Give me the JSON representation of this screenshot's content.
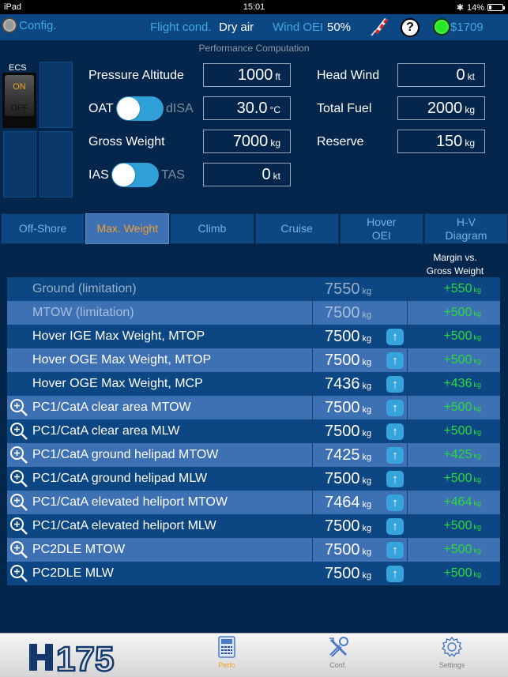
{
  "status_bar": {
    "device": "iPad",
    "time": "15:01",
    "battery": "14%"
  },
  "nav": {
    "config_label": "Config.",
    "flight_cond_label": "Flight cond.",
    "flight_cond_value": "Dry air",
    "wind_oei_label": "Wind OEI",
    "wind_oei_value": "50%",
    "help_label": "?",
    "status_code": "$1709"
  },
  "section_title": "Performance Computation",
  "ecs": {
    "label": "ECS",
    "on": "ON",
    "off": "OFF",
    "state": "ON"
  },
  "inputs": {
    "pressure_altitude": {
      "label": "Pressure Altitude",
      "value": "1000",
      "unit": "ft"
    },
    "oat": {
      "label": "OAT",
      "alt_label": "dISA",
      "value": "30.0",
      "unit": "°C",
      "toggle_on": true
    },
    "gross_weight": {
      "label": "Gross Weight",
      "value": "7000",
      "unit": "kg"
    },
    "ias": {
      "label": "IAS",
      "alt_label": "TAS",
      "value": "0",
      "unit": "kt",
      "toggle_on": true
    },
    "head_wind": {
      "label": "Head Wind",
      "value": "0",
      "unit": "kt"
    },
    "total_fuel": {
      "label": "Total Fuel",
      "value": "2000",
      "unit": "kg"
    },
    "reserve": {
      "label": "Reserve",
      "value": "150",
      "unit": "kg"
    }
  },
  "tabs": [
    {
      "label": "Off-Shore",
      "active": false
    },
    {
      "label": "Max. Weight",
      "active": true
    },
    {
      "label": "Climb",
      "active": false
    },
    {
      "label": "Cruise",
      "active": false
    },
    {
      "label": "Hover\nOEI",
      "active": false
    },
    {
      "label": "H-V\nDiagram",
      "active": false
    }
  ],
  "table": {
    "margin_header": "Margin vs.\nGross Weight",
    "unit": "kg",
    "rows": [
      {
        "name": "Ground (limitation)",
        "value": "7550",
        "margin": "+550",
        "zoom": false,
        "arrow": false,
        "disabled": true
      },
      {
        "name": "MTOW (limitation)",
        "value": "7500",
        "margin": "+500",
        "zoom": false,
        "arrow": false,
        "disabled": true
      },
      {
        "name": "Hover IGE Max Weight, MTOP",
        "value": "7500",
        "margin": "+500",
        "zoom": false,
        "arrow": true,
        "disabled": false
      },
      {
        "name": "Hover OGE Max Weight, MTOP",
        "value": "7500",
        "margin": "+500",
        "zoom": false,
        "arrow": true,
        "disabled": false
      },
      {
        "name": "Hover OGE Max Weight, MCP",
        "value": "7436",
        "margin": "+436",
        "zoom": false,
        "arrow": true,
        "disabled": false
      },
      {
        "name": "PC1/CatA clear area MTOW",
        "value": "7500",
        "margin": "+500",
        "zoom": true,
        "arrow": true,
        "disabled": false
      },
      {
        "name": "PC1/CatA clear area MLW",
        "value": "7500",
        "margin": "+500",
        "zoom": true,
        "arrow": true,
        "disabled": false
      },
      {
        "name": "PC1/CatA ground helipad MTOW",
        "value": "7425",
        "margin": "+425",
        "zoom": true,
        "arrow": true,
        "disabled": false
      },
      {
        "name": "PC1/CatA ground helipad MLW",
        "value": "7500",
        "margin": "+500",
        "zoom": true,
        "arrow": true,
        "disabled": false
      },
      {
        "name": "PC1/CatA elevated heliport MTOW",
        "value": "7464",
        "margin": "+464",
        "zoom": true,
        "arrow": true,
        "disabled": false
      },
      {
        "name": "PC1/CatA elevated heliport MLW",
        "value": "7500",
        "margin": "+500",
        "zoom": true,
        "arrow": true,
        "disabled": false
      },
      {
        "name": "PC2DLE MTOW",
        "value": "7500",
        "margin": "+500",
        "zoom": true,
        "arrow": true,
        "disabled": false
      },
      {
        "name": "PC2DLE MLW",
        "value": "7500",
        "margin": "+500",
        "zoom": true,
        "arrow": true,
        "disabled": false
      }
    ]
  },
  "tab_bar": {
    "logo": "H175",
    "items": [
      {
        "label": "Perfo",
        "icon": "calculator-icon",
        "active": true
      },
      {
        "label": "Conf.",
        "icon": "tools-icon",
        "active": false
      },
      {
        "label": "Settings",
        "icon": "gear-icon",
        "active": false
      }
    ]
  },
  "colors": {
    "accent_orange": "#f0a030",
    "margin_green": "#2adb3a",
    "link_blue": "#3fa9e0",
    "bg_navy": "#04264c"
  }
}
